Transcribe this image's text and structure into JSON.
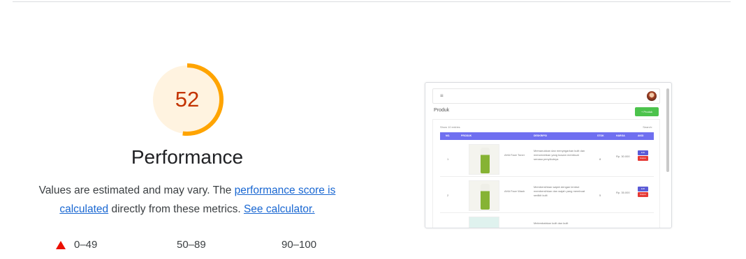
{
  "score": {
    "value": "52",
    "fraction": 0.52,
    "color": "#ffa400",
    "bg": "#fff3e0",
    "text_color": "#c33300"
  },
  "category": {
    "title": "Performance"
  },
  "description": {
    "text1": "Values are estimated and may vary. The ",
    "link1": "performance score is calculated",
    "text2": " directly from these metrics. ",
    "link2": "See calculator."
  },
  "legend": [
    {
      "range": "0–49",
      "icon": "fail-triangle-icon",
      "color": "#eb0f00"
    },
    {
      "range": "50–89",
      "icon": "",
      "color": ""
    },
    {
      "range": "90–100",
      "icon": "",
      "color": ""
    }
  ],
  "screenshot": {
    "menu_icon": "≡",
    "heading": "Produk",
    "add_button": "+ Produk",
    "controls": "Show 10 entries",
    "search": "Search:",
    "columns": [
      "NO.",
      "PRODUK",
      "DESKRIPSI",
      "STOK",
      "HARGA",
      "AKSI"
    ],
    "rows": [
      {
        "no": "1",
        "name": "AHA Face Toner",
        "desc": "Memanukkan dan menyegarkan kulit dan mencerahkan yang kusam membuat senasa penyikutnya",
        "stock": "8",
        "price": "Rp. 30.000",
        "edit": "Edit",
        "delete": "Hapus"
      },
      {
        "no": "2",
        "name": "AHA Face Wash",
        "desc": "Membersihkan wajah dengan lembut membersihkan dan wajah yang membuat sedikit kulit",
        "stock": "5",
        "price": "Rp. 35.000",
        "edit": "Edit",
        "delete": "Hapus"
      },
      {
        "no": "3",
        "name": "",
        "desc": "Melembabkan kulit dan kulit",
        "stock": "",
        "price": "",
        "edit": "",
        "delete": ""
      }
    ]
  }
}
